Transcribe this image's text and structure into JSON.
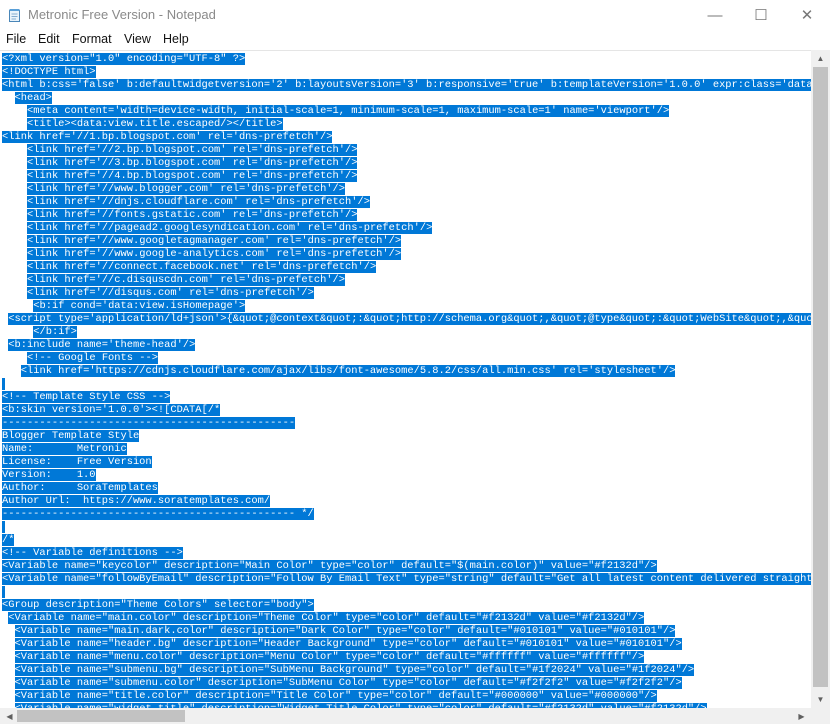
{
  "window": {
    "title": "Metronic Free Version - Notepad",
    "controls": {
      "minimize": "—",
      "maximize": "☐",
      "close": "✕"
    }
  },
  "menu": [
    "File",
    "Edit",
    "Format",
    "View",
    "Help"
  ],
  "colors": {
    "selection": "#0078d7",
    "selection_text": "#ffffff"
  },
  "scrollbars": {
    "vertical_up": "▲",
    "vertical_down": "▼",
    "horizontal_left": "◀",
    "horizontal_right": "▶"
  },
  "lines": [
    {
      "indent": "",
      "text": "<?xml version=\"1.0\" encoding=\"UTF-8\" ?>"
    },
    {
      "indent": "",
      "text": "<!DOCTYPE html>"
    },
    {
      "indent": "",
      "text": "<html b:css='false' b:defaultwidgetversion='2' b:layoutsVersion='3' b:responsive='true' b:templateVersion='1.0.0' expr:class='data:blo"
    },
    {
      "indent": "  ",
      "text": "<head>"
    },
    {
      "indent": "    ",
      "text": "<meta content='width=device-width, initial-scale=1, minimum-scale=1, maximum-scale=1' name='viewport'/>"
    },
    {
      "indent": "    ",
      "text": "<title><data:view.title.escaped/></title>"
    },
    {
      "indent": "",
      "text": "<link href='//1.bp.blogspot.com' rel='dns-prefetch'/>"
    },
    {
      "indent": "    ",
      "text": "<link href='//2.bp.blogspot.com' rel='dns-prefetch'/>"
    },
    {
      "indent": "    ",
      "text": "<link href='//3.bp.blogspot.com' rel='dns-prefetch'/>"
    },
    {
      "indent": "    ",
      "text": "<link href='//4.bp.blogspot.com' rel='dns-prefetch'/>"
    },
    {
      "indent": "    ",
      "text": "<link href='//www.blogger.com' rel='dns-prefetch'/>"
    },
    {
      "indent": "    ",
      "text": "<link href='//dnjs.cloudflare.com' rel='dns-prefetch'/>"
    },
    {
      "indent": "    ",
      "text": "<link href='//fonts.gstatic.com' rel='dns-prefetch'/>"
    },
    {
      "indent": "    ",
      "text": "<link href='//pagead2.googlesyndication.com' rel='dns-prefetch'/>"
    },
    {
      "indent": "    ",
      "text": "<link href='//www.googletagmanager.com' rel='dns-prefetch'/>"
    },
    {
      "indent": "    ",
      "text": "<link href='//www.google-analytics.com' rel='dns-prefetch'/>"
    },
    {
      "indent": "    ",
      "text": "<link href='//connect.facebook.net' rel='dns-prefetch'/>"
    },
    {
      "indent": "    ",
      "text": "<link href='//c.disquscdn.com' rel='dns-prefetch'/>"
    },
    {
      "indent": "    ",
      "text": "<link href='//disqus.com' rel='dns-prefetch'/>"
    },
    {
      "indent": "     ",
      "text": "<b:if cond='data:view.isHomepage'>"
    },
    {
      "indent": " ",
      "text": "<script type='application/ld+json'>{&quot;@context&quot;:&quot;http://schema.org&quot;,&quot;@type&quot;:&quot;WebSite&quot;,&quot;na"
    },
    {
      "indent": "     ",
      "text": "</b:if>"
    },
    {
      "indent": " ",
      "text": "<b:include name='theme-head'/>"
    },
    {
      "indent": "    ",
      "text": "<!-- Google Fonts -->"
    },
    {
      "indent": "   ",
      "text": "<link href='https://cdnjs.cloudflare.com/ajax/libs/font-awesome/5.8.2/css/all.min.css' rel='stylesheet'/>"
    },
    {
      "indent": "",
      "text": ""
    },
    {
      "indent": "",
      "text": "<!-- Template Style CSS -->"
    },
    {
      "indent": "",
      "text": "<b:skin version='1.0.0'><![CDATA[/*"
    },
    {
      "indent": "",
      "text": "-----------------------------------------------"
    },
    {
      "indent": "",
      "text": "Blogger Template Style"
    },
    {
      "indent": "",
      "text": "Name:       Metronic"
    },
    {
      "indent": "",
      "text": "License:    Free Version"
    },
    {
      "indent": "",
      "text": "Version:    1.0"
    },
    {
      "indent": "",
      "text": "Author:     SoraTemplates"
    },
    {
      "indent": "",
      "text": "Author Url:  https://www.soratemplates.com/"
    },
    {
      "indent": "",
      "text": "----------------------------------------------- */"
    },
    {
      "indent": "",
      "text": ""
    },
    {
      "indent": "",
      "text": "/*"
    },
    {
      "indent": "",
      "text": "<!-- Variable definitions -->"
    },
    {
      "indent": "",
      "text": "<Variable name=\"keycolor\" description=\"Main Color\" type=\"color\" default=\"$(main.color)\" value=\"#f2132d\"/>"
    },
    {
      "indent": "",
      "text": "<Variable name=\"followByEmail\" description=\"Follow By Email Text\" type=\"string\" default=\"Get all latest content delivered straight to"
    },
    {
      "indent": "",
      "text": ""
    },
    {
      "indent": "",
      "text": "<Group description=\"Theme Colors\" selector=\"body\">"
    },
    {
      "indent": " ",
      "text": "<Variable name=\"main.color\" description=\"Theme Color\" type=\"color\" default=\"#f2132d\" value=\"#f2132d\"/>"
    },
    {
      "indent": "  ",
      "text": "<Variable name=\"main.dark.color\" description=\"Dark Color\" type=\"color\" default=\"#010101\" value=\"#010101\"/>"
    },
    {
      "indent": "  ",
      "text": "<Variable name=\"header.bg\" description=\"Header Background\" type=\"color\" default=\"#010101\" value=\"#010101\"/>"
    },
    {
      "indent": "  ",
      "text": "<Variable name=\"menu.color\" description=\"Menu Color\" type=\"color\" default=\"#ffffff\" value=\"#ffffff\"/>"
    },
    {
      "indent": "  ",
      "text": "<Variable name=\"submenu.bg\" description=\"SubMenu Background\" type=\"color\" default=\"#1f2024\" value=\"#1f2024\"/>"
    },
    {
      "indent": "  ",
      "text": "<Variable name=\"submenu.color\" description=\"SubMenu Color\" type=\"color\" default=\"#f2f2f2\" value=\"#f2f2f2\"/>"
    },
    {
      "indent": "  ",
      "text": "<Variable name=\"title.color\" description=\"Title Color\" type=\"color\" default=\"#000000\" value=\"#000000\"/>"
    },
    {
      "indent": "  ",
      "text": "<Variable name=\"widget.title\" description=\"Widget Title Color\" type=\"color\" default=\"#f2132d\" value=\"#f2132d\"/>"
    }
  ]
}
